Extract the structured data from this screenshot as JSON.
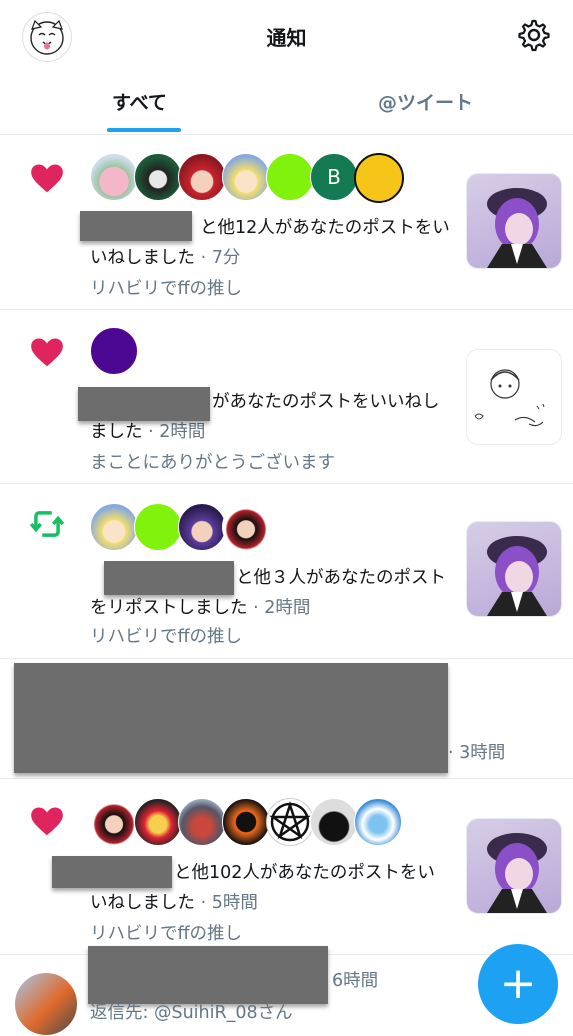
{
  "header": {
    "title": "通知"
  },
  "tabs": [
    {
      "label": "すべて"
    },
    {
      "label": "@ツイート"
    }
  ],
  "notifications": [
    {
      "kind": "like",
      "text": "と他12人があなたのポストをいいねしました",
      "time": "7分",
      "context": "リハビリでffの推し",
      "avatar_b": "B"
    },
    {
      "kind": "like",
      "text": "があなたのポストをいいねしました",
      "time": "2時間",
      "context": "まことにありがとうございます"
    },
    {
      "kind": "retweet",
      "text": "と他３人があなたのポストをリポストしました",
      "time": "2時間",
      "context": "リハビリでffの推し"
    },
    {
      "kind": "redacted",
      "time": "3時間"
    },
    {
      "kind": "like",
      "text": "と他102人があなたのポストをいいねしました",
      "time": "5時間",
      "context": "リハビリでffの推し"
    },
    {
      "kind": "reply",
      "time": "6時間",
      "reply_to": "返信先: @SuihiR_08さん"
    }
  ],
  "fab": {
    "label": "+"
  },
  "colors": {
    "accent": "#1da1f2",
    "like": "#e0245e",
    "retweet": "#17bf63"
  }
}
